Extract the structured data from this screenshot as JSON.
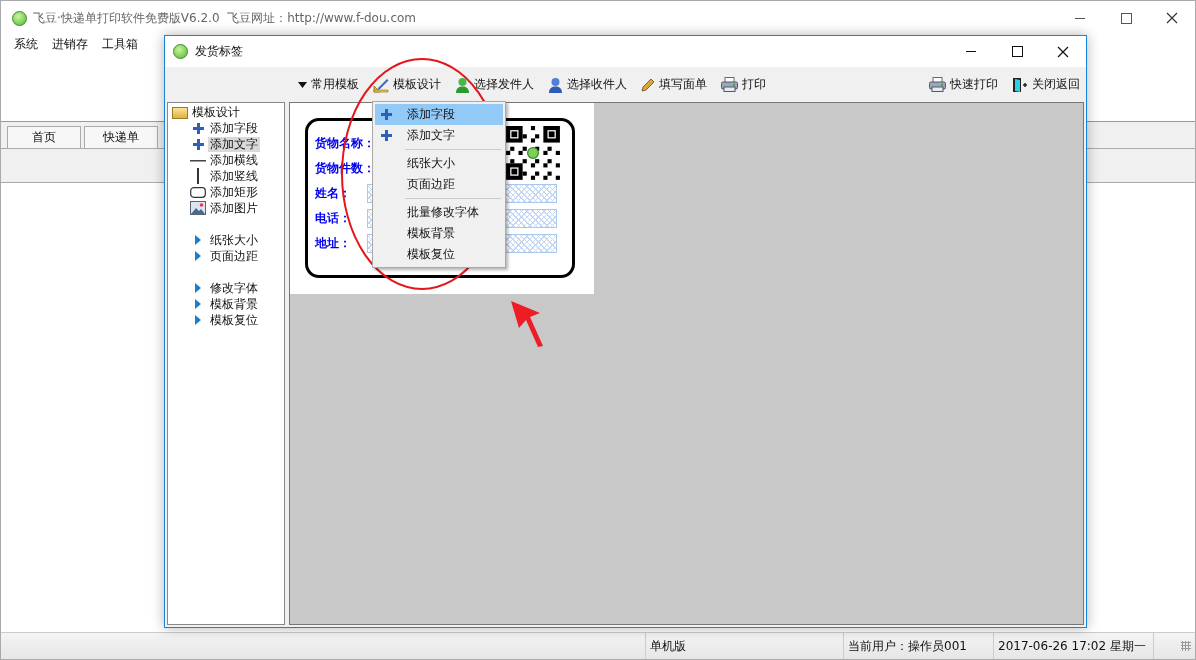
{
  "main_window": {
    "title": "飞豆·快递单打印软件免费版V6.2.0  飞豆网址：http://www.f-dou.com",
    "menu": [
      "系统",
      "进销存",
      "工具箱"
    ],
    "tabs": [
      {
        "label": "首页"
      },
      {
        "label": "快递单"
      }
    ],
    "status_bar": [
      "单机版",
      "当前用户：操作员001",
      "2017-06-26 17:02 星期一"
    ]
  },
  "dialog": {
    "title": "发货标签",
    "toolbar_left": [
      {
        "label": "常用模板",
        "kind": "caret"
      },
      {
        "label": "模板设计",
        "kind": "ruler"
      },
      {
        "label": "选择发件人",
        "kind": "sender"
      },
      {
        "label": "选择收件人",
        "kind": "recipient"
      },
      {
        "label": "填写面单",
        "kind": "pencil"
      },
      {
        "label": "打印",
        "kind": "printer"
      }
    ],
    "toolbar_right": [
      {
        "label": "快速打印",
        "kind": "printer"
      },
      {
        "label": "关闭返回",
        "kind": "door"
      }
    ],
    "tree": {
      "label": "模板设计",
      "sections": [
        {
          "items": [
            {
              "label": "添加字段",
              "kind": "plus",
              "selected": false
            },
            {
              "label": "添加文字",
              "kind": "plus",
              "selected": true
            },
            {
              "label": "添加横线",
              "kind": "hline",
              "selected": false
            },
            {
              "label": "添加竖线",
              "kind": "vline",
              "selected": false
            },
            {
              "label": "添加矩形",
              "kind": "rect",
              "selected": false
            },
            {
              "label": "添加图片",
              "kind": "picture",
              "selected": false
            }
          ]
        },
        {
          "items": [
            {
              "label": "纸张大小",
              "kind": "triangle",
              "selected": false
            },
            {
              "label": "页面边距",
              "kind": "triangle",
              "selected": false
            }
          ]
        },
        {
          "items": [
            {
              "label": "修改字体",
              "kind": "triangle",
              "selected": false
            },
            {
              "label": "模板背景",
              "kind": "triangle",
              "selected": false
            },
            {
              "label": "模板复位",
              "kind": "triangle",
              "selected": false
            }
          ]
        }
      ]
    },
    "label_fields": [
      {
        "label": "货物名称："
      },
      {
        "label": "货物件数："
      },
      {
        "label": "姓名："
      },
      {
        "label": "电话："
      },
      {
        "label": "地址："
      }
    ],
    "dropdown": [
      {
        "items": [
          {
            "label": "添加字段",
            "kind": "plus",
            "selected": true
          },
          {
            "label": "添加文字",
            "kind": "plus",
            "selected": false
          }
        ]
      },
      {
        "items": [
          {
            "label": "纸张大小",
            "kind": "plain",
            "selected": false
          },
          {
            "label": "页面边距",
            "kind": "plain",
            "selected": false
          }
        ]
      },
      {
        "items": [
          {
            "label": "批量修改字体",
            "kind": "plain",
            "selected": false
          },
          {
            "label": "模板背景",
            "kind": "plain",
            "selected": false
          },
          {
            "label": "模板复位",
            "kind": "plain",
            "selected": false
          }
        ]
      }
    ]
  }
}
